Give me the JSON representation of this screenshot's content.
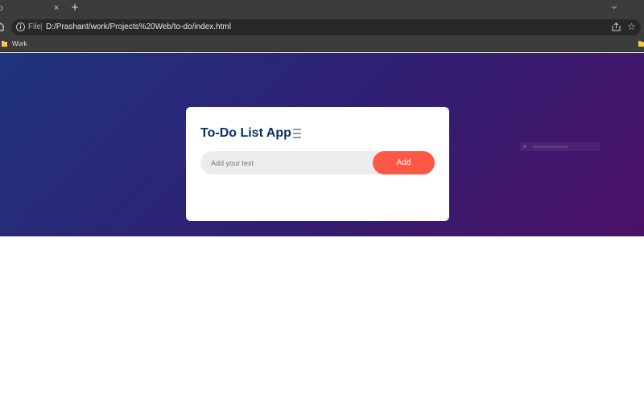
{
  "browser": {
    "tab": {
      "title": "o",
      "close_glyph": "×"
    },
    "new_tab_glyph": "+",
    "address_bar": {
      "scheme_label": "File",
      "url": "D:/Prashant/work/Projects%20Web/to-do/index.html"
    },
    "star_glyph": "☆",
    "bookmarks": [
      {
        "label": "Work",
        "icon": "folder-icon"
      }
    ],
    "icons": [
      "home-icon",
      "info-icon",
      "share-icon",
      "star-icon",
      "chevron-down-icon"
    ]
  },
  "app": {
    "title": "To-Do List App",
    "menu_icon": "menu-icon",
    "input_placeholder": "Add your text",
    "input_value": "",
    "add_label": "Add"
  },
  "colors": {
    "gradient_start": "#1f347e",
    "gradient_end": "#4b1066",
    "title": "#0b2f6b",
    "add_button": "#ff5945",
    "input_bg": "#ececef",
    "browser_chrome": "#3c3c3c"
  }
}
